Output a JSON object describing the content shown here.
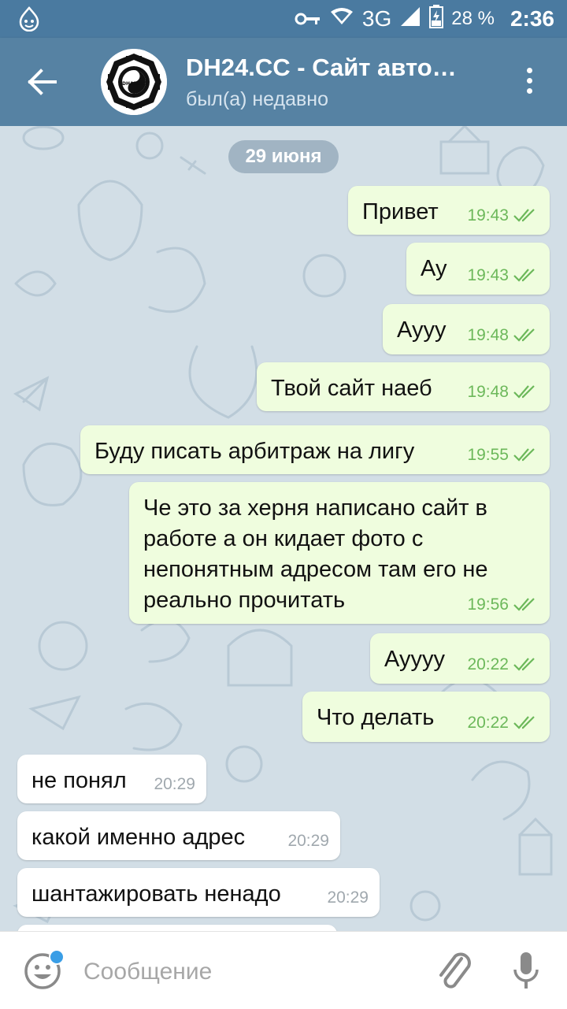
{
  "status_bar": {
    "network": "3G",
    "battery": "28 %",
    "time": "2:36"
  },
  "header": {
    "title": "DH24.CC - Сайт авто…",
    "subtitle": "был(а) недавно",
    "avatar_text": "DHARMA"
  },
  "chat": {
    "date_label": "29 июня",
    "messages": [
      {
        "direction": "out",
        "text": "Привет",
        "time": "19:43",
        "read": true
      },
      {
        "direction": "out",
        "text": "Ау",
        "time": "19:43",
        "read": true
      },
      {
        "direction": "out",
        "text": "Аууу",
        "time": "19:48",
        "read": true
      },
      {
        "direction": "out",
        "text": "Твой сайт наеб",
        "time": "19:48",
        "read": true
      },
      {
        "direction": "out",
        "text": "Буду писать арбитраж на лигу",
        "time": "19:55",
        "read": true
      },
      {
        "direction": "out",
        "text": "Че это за херня написано сайт в работе а он кидает фото с непонятным адресом там его не реально прочитать",
        "time": "19:56",
        "read": true
      },
      {
        "direction": "out",
        "text": "Ауууу",
        "time": "20:22",
        "read": true
      },
      {
        "direction": "out",
        "text": "Что делать",
        "time": "20:22",
        "read": true
      },
      {
        "direction": "in",
        "text": "не понял",
        "time": "20:29"
      },
      {
        "direction": "in",
        "text": "какой именно адрес",
        "time": "20:29"
      },
      {
        "direction": "in",
        "text": "шантажировать ненадо",
        "time": "20:29"
      }
    ]
  },
  "composer": {
    "placeholder": "Сообщение"
  },
  "colors": {
    "header": "#5682a3",
    "status_bar": "#4a7aa0",
    "outgoing_bubble": "#effdde",
    "time_green": "#6cb85a"
  }
}
